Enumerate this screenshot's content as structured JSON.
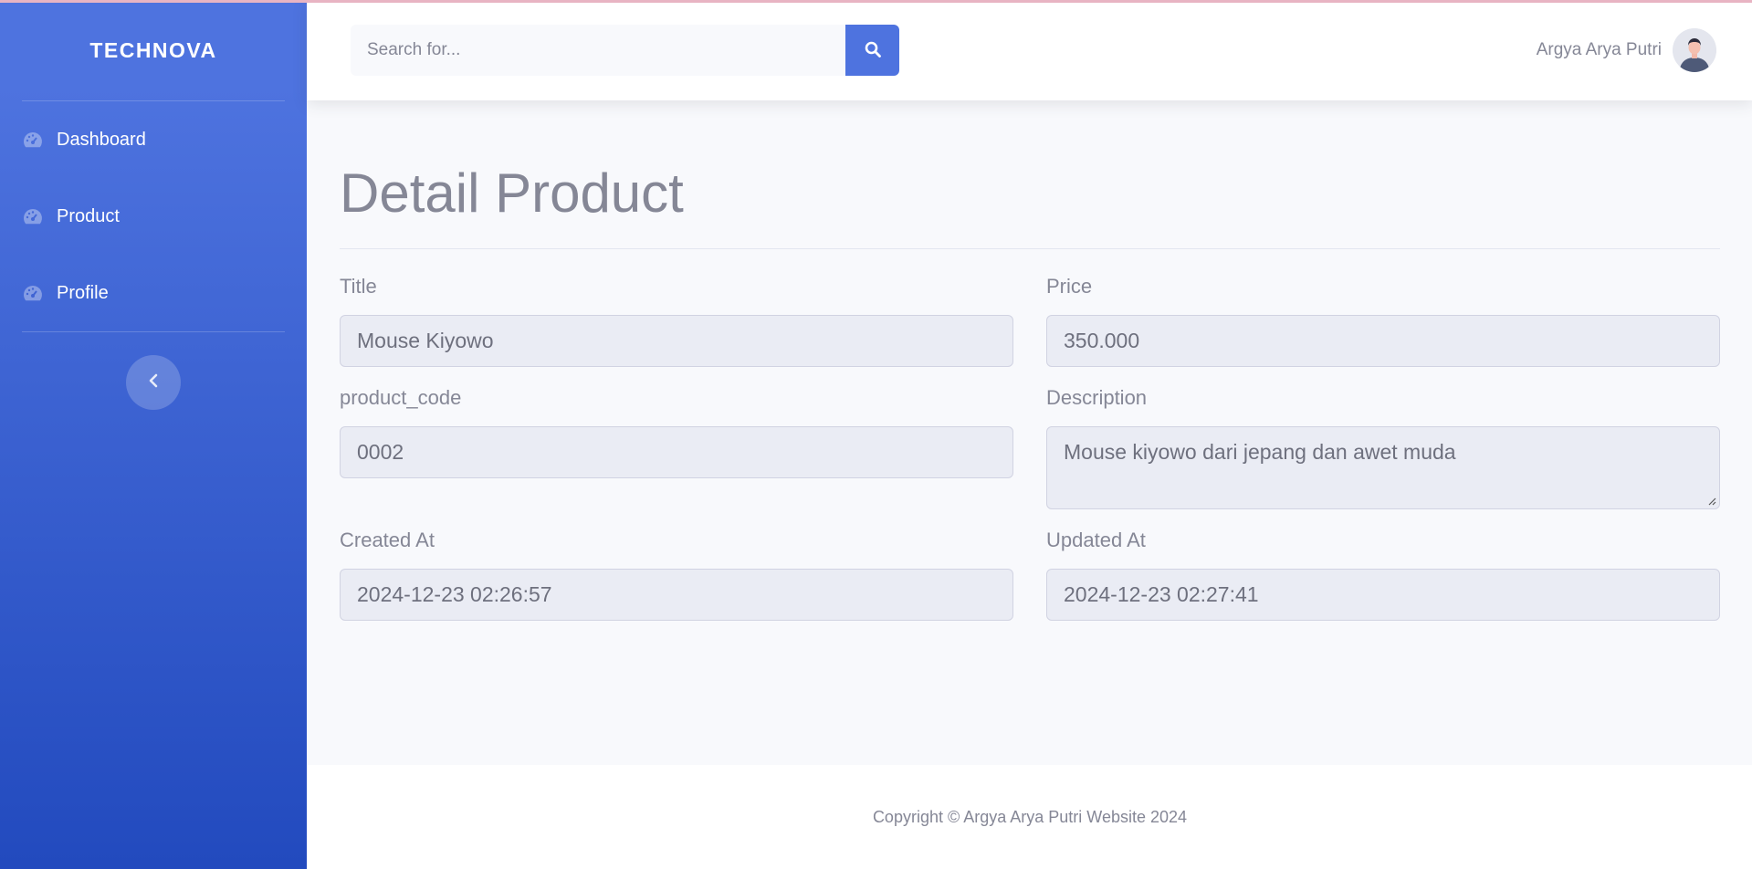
{
  "brand": {
    "name": "TECHNOVA"
  },
  "sidebar": {
    "items": [
      {
        "label": "Dashboard",
        "icon": "tachometer-icon"
      },
      {
        "label": "Product",
        "icon": "tachometer-icon"
      },
      {
        "label": "Profile",
        "icon": "tachometer-icon"
      }
    ],
    "toggle_icon": "chevron-left-icon"
  },
  "topbar": {
    "search": {
      "placeholder": "Search for...",
      "value": ""
    },
    "user": {
      "name": "Argya Arya Putri"
    }
  },
  "main": {
    "title": "Detail Product",
    "fields": {
      "title": {
        "label": "Title",
        "value": "Mouse Kiyowo"
      },
      "price": {
        "label": "Price",
        "value": "350.000"
      },
      "product_code": {
        "label": "product_code",
        "value": "0002"
      },
      "description": {
        "label": "Description",
        "value": "Mouse kiyowo dari jepang dan awet muda"
      },
      "created_at": {
        "label": "Created At",
        "value": "2024-12-23 02:26:57"
      },
      "updated_at": {
        "label": "Updated At",
        "value": "2024-12-23 02:27:41"
      }
    }
  },
  "footer": {
    "text": "Copyright © Argya Arya Putri Website 2024"
  },
  "colors": {
    "primary": "#4e73df",
    "primary_dark": "#224abe",
    "text_muted": "#858796",
    "input_bg": "#eaecf4"
  }
}
